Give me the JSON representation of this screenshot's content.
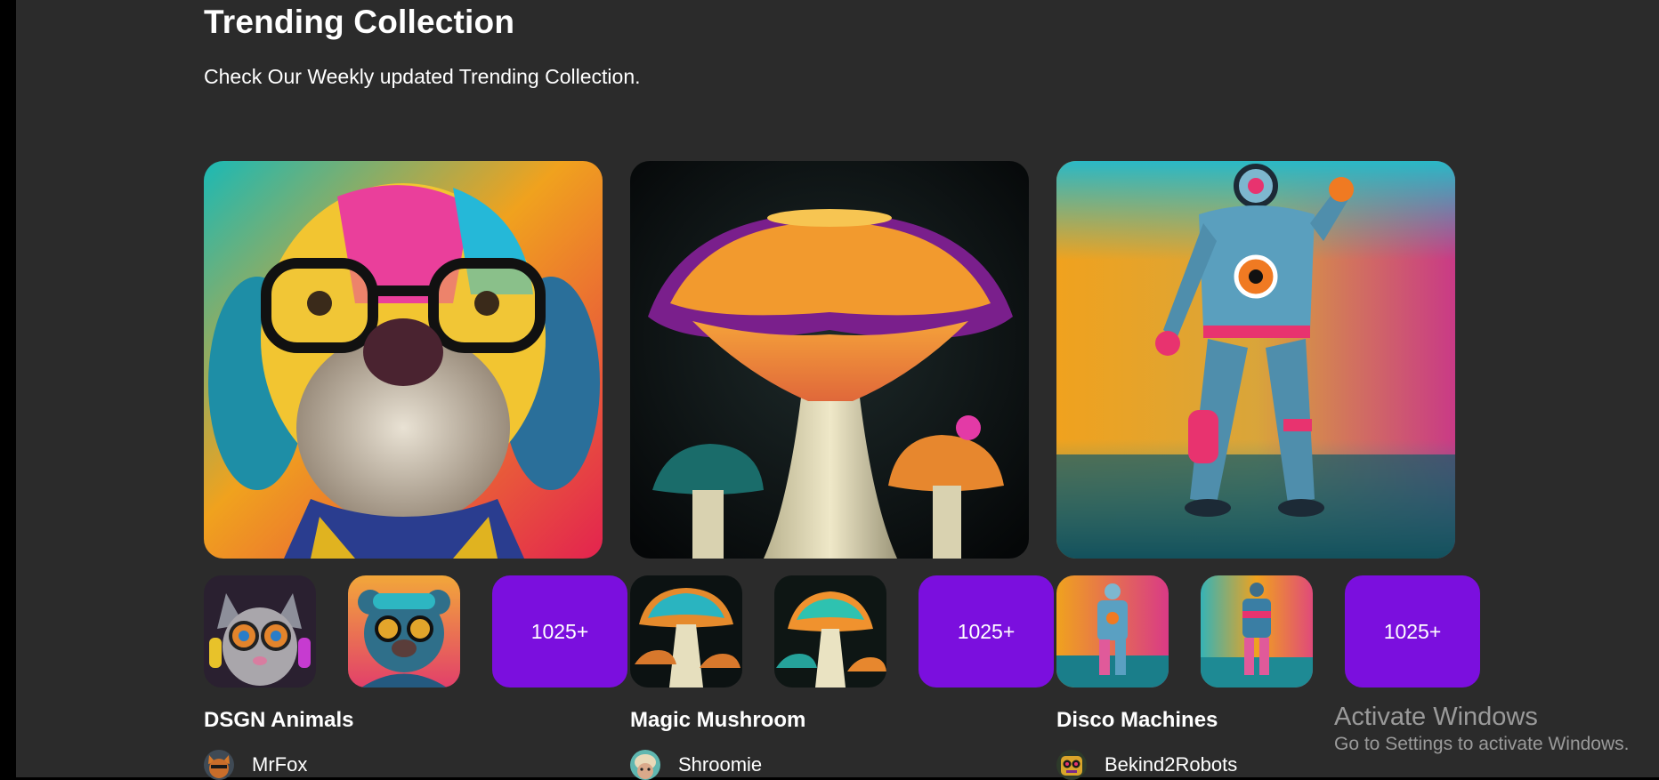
{
  "header": {
    "title": "Trending Collection",
    "subtitle": "Check Our Weekly updated Trending Collection."
  },
  "collections": [
    {
      "name": "DSGN Animals",
      "more_label": "1025+",
      "creator": "MrFox",
      "hero_icon": "dog-with-glasses-image",
      "accent": "#e6305f"
    },
    {
      "name": "Magic Mushroom",
      "more_label": "1025+",
      "creator": "Shroomie",
      "hero_icon": "mushroom-image",
      "accent": "#f08a24"
    },
    {
      "name": "Disco Machines",
      "more_label": "1025+",
      "creator": "Bekind2Robots",
      "hero_icon": "robot-image",
      "accent": "#1fb3b8"
    }
  ],
  "colors": {
    "page_bg": "#2b2b2b",
    "more_button_bg": "#7b0fde",
    "text": "#ffffff"
  },
  "watermark": {
    "line1": "Activate Windows",
    "line2": "Go to Settings to activate Windows."
  }
}
